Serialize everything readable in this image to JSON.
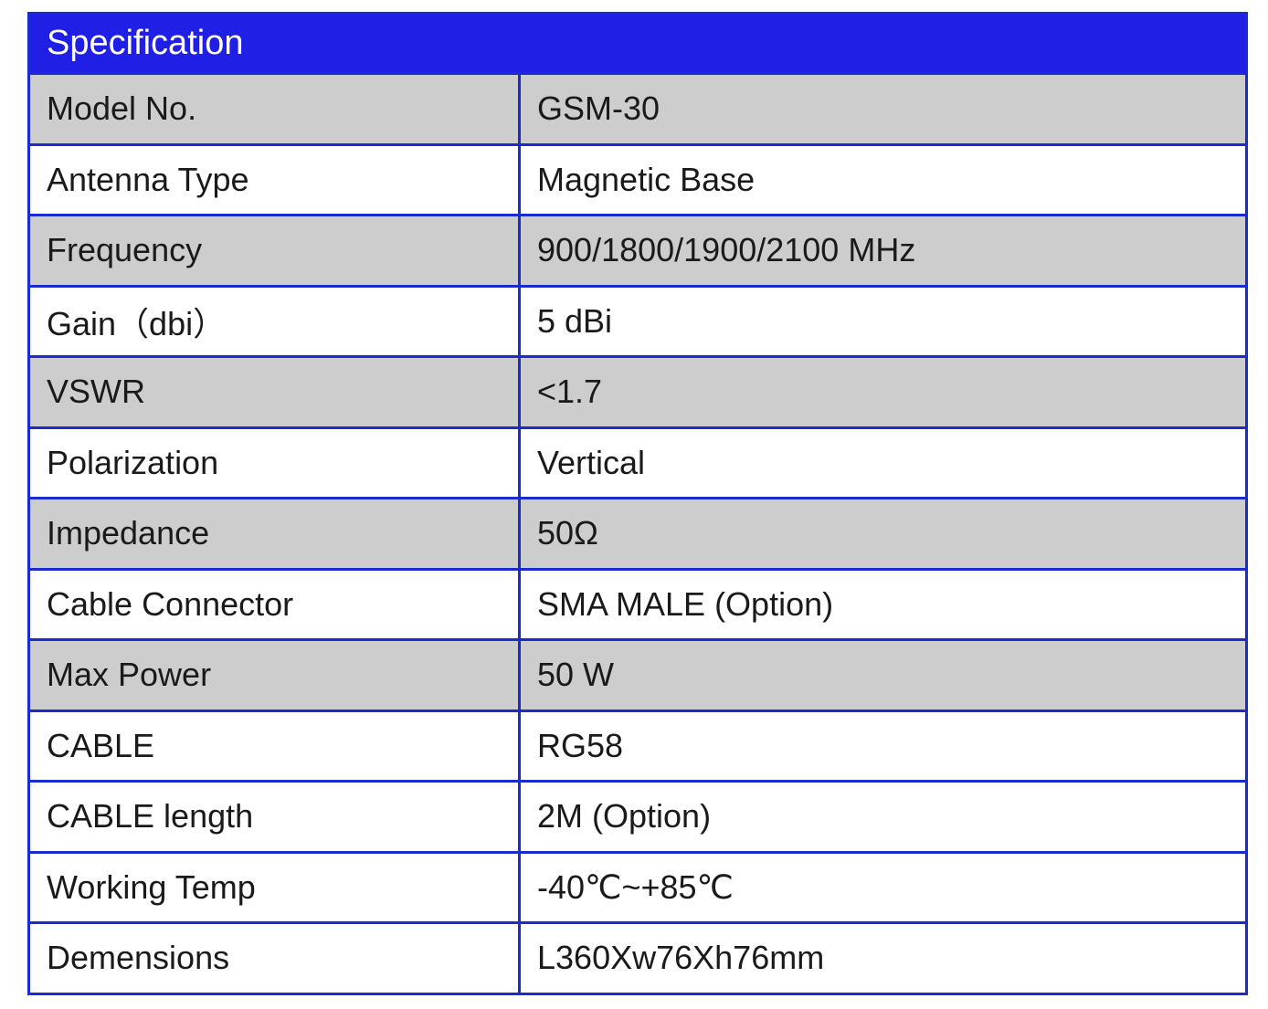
{
  "table": {
    "header": "Specification",
    "rows": [
      {
        "label": "Model No.",
        "value": "GSM-30",
        "shaded": true
      },
      {
        "label": "Antenna Type",
        "value": "Magnetic Base",
        "shaded": false
      },
      {
        "label": "Frequency",
        "value": "900/1800/1900/2100 MHz",
        "shaded": true
      },
      {
        "label": "Gain（dbi）",
        "value": "5 dBi",
        "shaded": false
      },
      {
        "label": "VSWR",
        "value": "<1.7",
        "shaded": true
      },
      {
        "label": "Polarization",
        "value": "Vertical",
        "shaded": false
      },
      {
        "label": "Impedance",
        "value": "50Ω",
        "shaded": true
      },
      {
        "label": "Cable Connector",
        "value": "SMA MALE (Option)",
        "shaded": false
      },
      {
        "label": "Max Power",
        "value": "50 W",
        "shaded": true
      },
      {
        "label": "CABLE",
        "value": "RG58",
        "shaded": false
      },
      {
        "label": "CABLE length",
        "value": "2M (Option)",
        "shaded": false
      },
      {
        "label": "Working Temp",
        "value": "-40℃~+85℃",
        "shaded": false
      },
      {
        "label": "Demensions",
        "value": "L360Xw76Xh76mm",
        "shaded": false
      }
    ]
  }
}
